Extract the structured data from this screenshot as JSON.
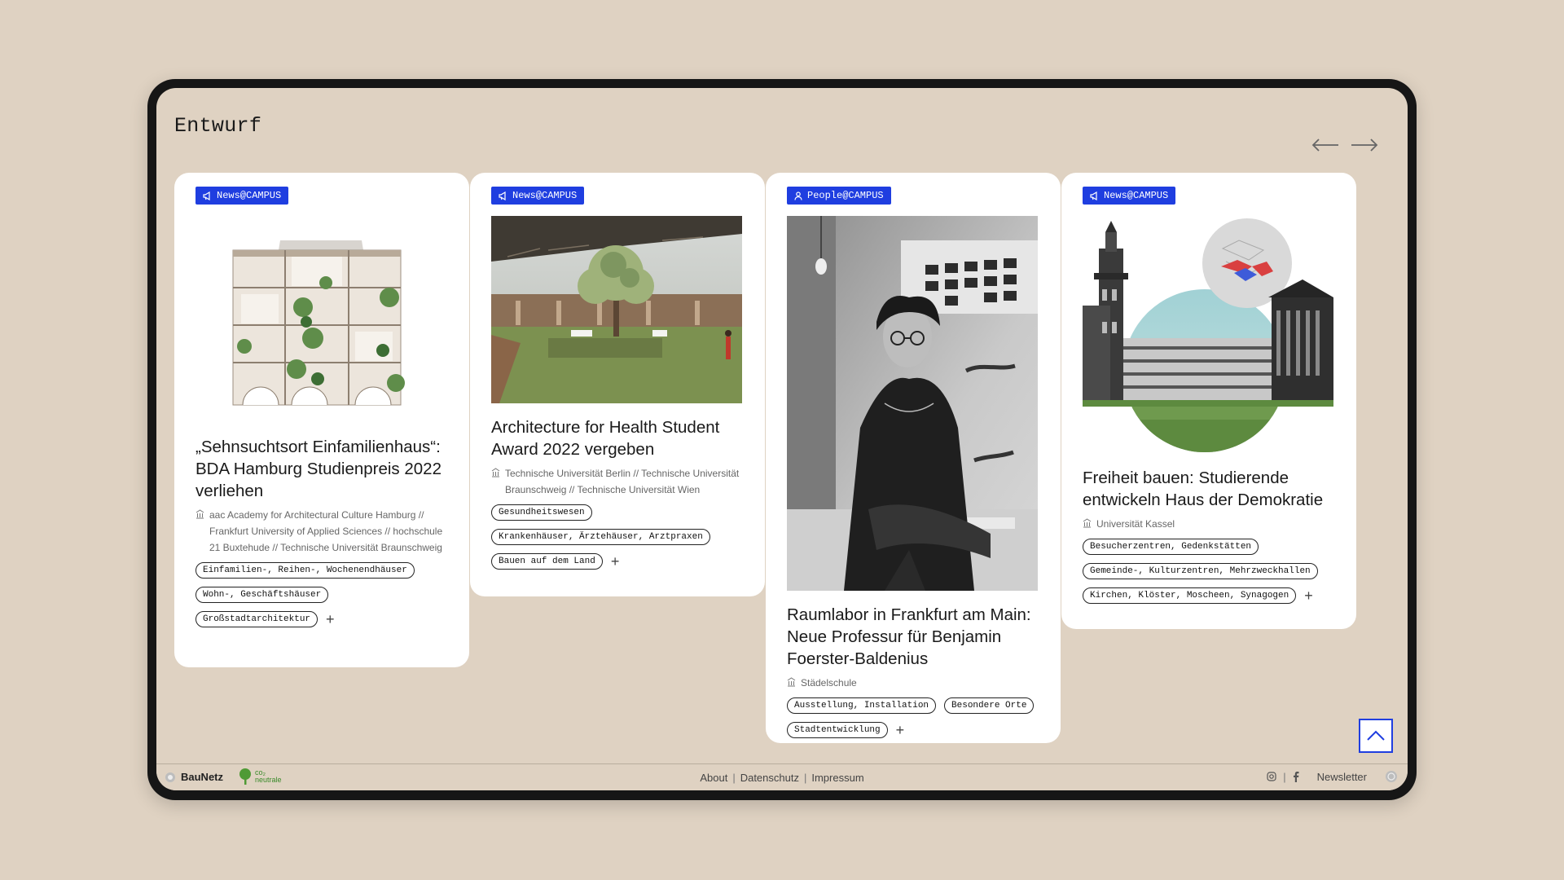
{
  "page": {
    "title": "Entwurf"
  },
  "colors": {
    "background": "#dfd2c2",
    "accent": "#1f3ee0",
    "frame": "#161616"
  },
  "nav": {
    "prev_icon": "arrow-left-icon",
    "next_icon": "arrow-right-icon"
  },
  "cards": [
    {
      "badge": "News@CAMPUS",
      "badge_icon": "megaphone-icon",
      "image": "house-cutaway-illustration",
      "title": "„Sehnsuchtsort Einfamilienhaus“: BDA Hamburg Studienpreis 2022 verliehen",
      "meta": "aac Academy for Architectural Culture Hamburg // Frankfurt University of Applied Sciences // hochschule 21 Buxtehude // Technische Universität Braunschweig",
      "tags": [
        "Einfamilien-, Reihen-, Wochenendhäuser",
        "Wohn-, Geschäftshäuser",
        "Großstadtarchitektur"
      ]
    },
    {
      "badge": "News@CAMPUS",
      "badge_icon": "megaphone-icon",
      "image": "garden-hall-rendering",
      "title": "Architecture for Health Student Award 2022 vergeben",
      "meta": "Technische Universität Berlin // Technische Universität Braunschweig // Technische Universität Wien",
      "tags": [
        "Gesundheitswesen",
        "Krankenhäuser, Ärztehäuser, Arztpraxen",
        "Bauen auf dem Land"
      ]
    },
    {
      "badge": "People@CAMPUS",
      "badge_icon": "person-icon",
      "image": "portrait-photo",
      "title": "Raumlabor in Frankfurt am Main: Neue Professur für Benjamin Foerster-Baldenius",
      "meta": "Städelschule",
      "tags": [
        "Ausstellung, Installation",
        "Besondere Orte",
        "Stadtentwicklung"
      ]
    },
    {
      "badge": "News@CAMPUS",
      "badge_icon": "megaphone-icon",
      "image": "collage-illustration",
      "title": "Freiheit bauen: Studierende entwickeln Haus der Demokratie",
      "meta": "Universität Kassel",
      "tags": [
        "Besucherzentren, Gedenkstätten",
        "Gemeinde-, Kulturzentren, Mehrzweckhallen",
        "Kirchen, Klöster, Moscheen, Synagogen"
      ]
    }
  ],
  "footer": {
    "brand": "BauNetz",
    "co2_line1": "co₂",
    "co2_line2": "neutrale",
    "links": [
      "About",
      "Datenschutz",
      "Impressum"
    ],
    "newsletter": "Newsletter",
    "social_icons": [
      "instagram-icon",
      "facebook-icon"
    ]
  }
}
